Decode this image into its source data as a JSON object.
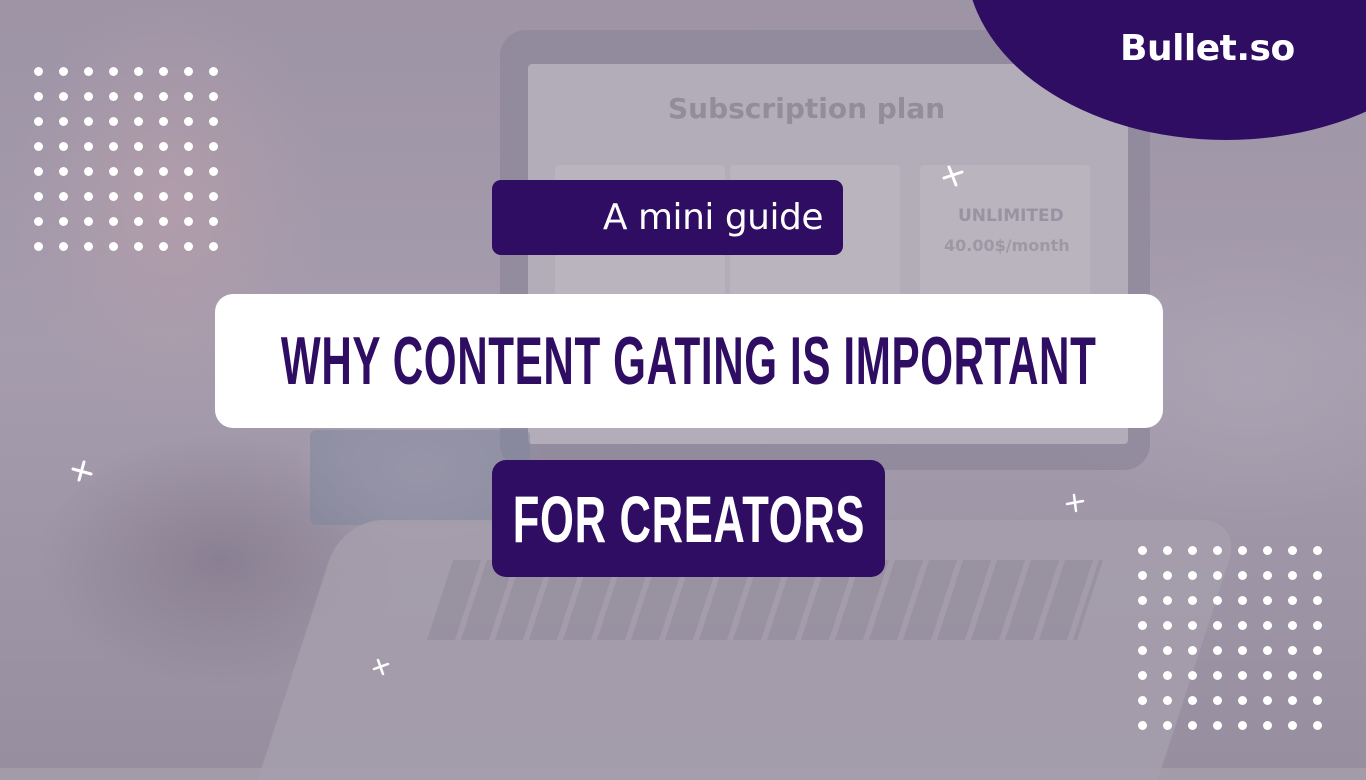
{
  "brand": {
    "name": "Bullet.so",
    "color": "#2E0D62"
  },
  "headline": {
    "kicker": "A mini guide",
    "title": "WHY CONTENT GATING IS IMPORTANT",
    "subtitle": "FOR CREATORS"
  },
  "background": {
    "screen_title": "Subscription plan",
    "plan_label": "UNLIMITED",
    "plan_price": "40.00$/month"
  },
  "colors": {
    "accent": "#2E0D62",
    "text_light": "#FFFFFF",
    "banner_bg": "#FFFFFF",
    "overlay": "#A39BA8"
  },
  "decorations": {
    "dot_grid_rows": 8,
    "dot_grid_cols": 8,
    "sparkle_icon": "plus-sparkle"
  }
}
